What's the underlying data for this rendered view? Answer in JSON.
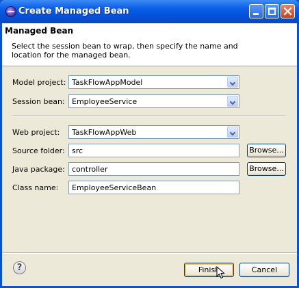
{
  "window": {
    "title": "Create Managed Bean",
    "icon": "eclipse-icon",
    "controls": [
      "minimize-icon",
      "maximize-icon",
      "close-icon"
    ]
  },
  "banner": {
    "title": "Managed Bean",
    "description": "Select the session bean to wrap, then specify the name and location for the managed bean."
  },
  "form": {
    "model_project": {
      "label": "Model project:",
      "value": "TaskFlowAppModel"
    },
    "session_bean": {
      "label": "Session bean:",
      "value": "EmployeeService"
    },
    "web_project": {
      "label": "Web project:",
      "value": "TaskFlowAppWeb"
    },
    "source_folder": {
      "label": "Source folder:",
      "value": "src",
      "button": "Browse..."
    },
    "java_package": {
      "label": "Java package:",
      "value": "controller",
      "button": "Browse..."
    },
    "class_name": {
      "label": "Class name:",
      "value": "EmployeeServiceBean"
    }
  },
  "footer": {
    "help_icon": "help-icon",
    "help_glyph": "?",
    "finish": "Finish",
    "cancel": "Cancel"
  }
}
